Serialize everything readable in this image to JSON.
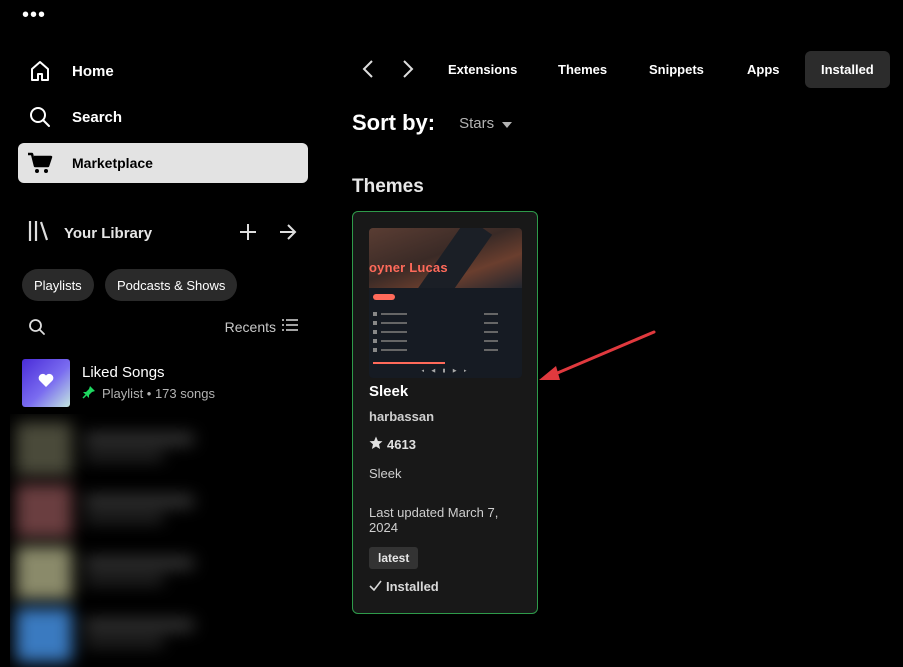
{
  "window": {
    "menu_icon": "more-dots-icon"
  },
  "sidebar": {
    "nav": [
      {
        "label": "Home",
        "icon": "home-icon"
      },
      {
        "label": "Search",
        "icon": "search-icon"
      },
      {
        "label": "Marketplace",
        "icon": "cart-icon"
      }
    ],
    "library": {
      "title": "Your Library",
      "filters": [
        "Playlists",
        "Podcasts & Shows"
      ],
      "sort_label": "Recents",
      "liked": {
        "title": "Liked Songs",
        "type": "Playlist",
        "count": "173 songs",
        "sub": "Playlist • 173 songs"
      }
    }
  },
  "topbar": {
    "tabs": [
      "Extensions",
      "Themes",
      "Snippets",
      "Apps",
      "Installed"
    ],
    "active_tab": "Installed"
  },
  "main": {
    "sort_label": "Sort by:",
    "sort_value": "Stars",
    "section_title": "Themes",
    "card": {
      "thumbnail_text": "oyner Lucas",
      "title": "Sleek",
      "author": "harbassan",
      "stars": "4613",
      "description": "Sleek",
      "updated": "Last updated March 7, 2024",
      "tag": "latest",
      "status": "Installed"
    }
  },
  "colors": {
    "accent_green": "#2e9a4a",
    "annotation_arrow": "#e0393e",
    "active_nav_bg": "#e3e3e3"
  }
}
